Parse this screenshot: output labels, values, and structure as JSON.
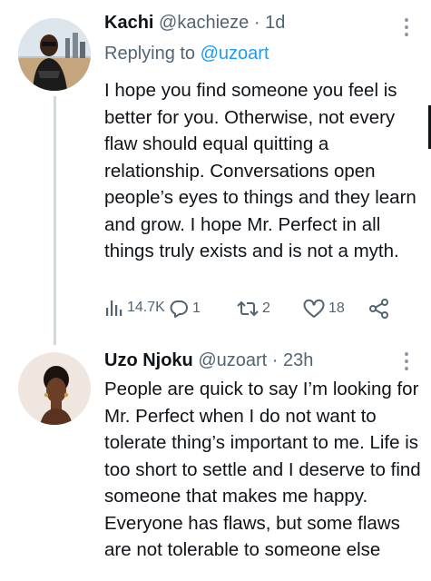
{
  "tweets": [
    {
      "display_name": "Kachi",
      "handle": "@kachieze",
      "separator": "·",
      "time": "1d",
      "replying_prefix": "Replying to",
      "replying_mention": "@uzoart",
      "text": "I hope you find someone you feel is better for you. Otherwise, not every flaw should equal quitting a relationship. Conversations open people’s eyes to things and they learn and grow. I hope Mr. Perfect in all things truly exists and is not a myth.",
      "views": "14.7K",
      "replies": "1",
      "retweets": "2",
      "likes": "18",
      "icons": [
        "views-icon",
        "reply-icon",
        "retweet-icon",
        "like-icon",
        "share-icon",
        "more-icon"
      ]
    },
    {
      "display_name": "Uzo Njoku",
      "handle": "@uzoart",
      "separator": "·",
      "time": "23h",
      "text": "People are quick to say I’m looking for Mr. Perfect when I do not want to tolerate thing’s important to me. Life is too short to settle and I deserve to find someone that makes me happy. Everyone has flaws, but some flaws are not tolerable to someone else",
      "icons": [
        "more-icon"
      ]
    }
  ],
  "colors": {
    "text": "#0f1419",
    "secondary": "#536471",
    "link": "#1d9bf0",
    "thread_line": "#cfd9de",
    "background": "#ffffff"
  }
}
